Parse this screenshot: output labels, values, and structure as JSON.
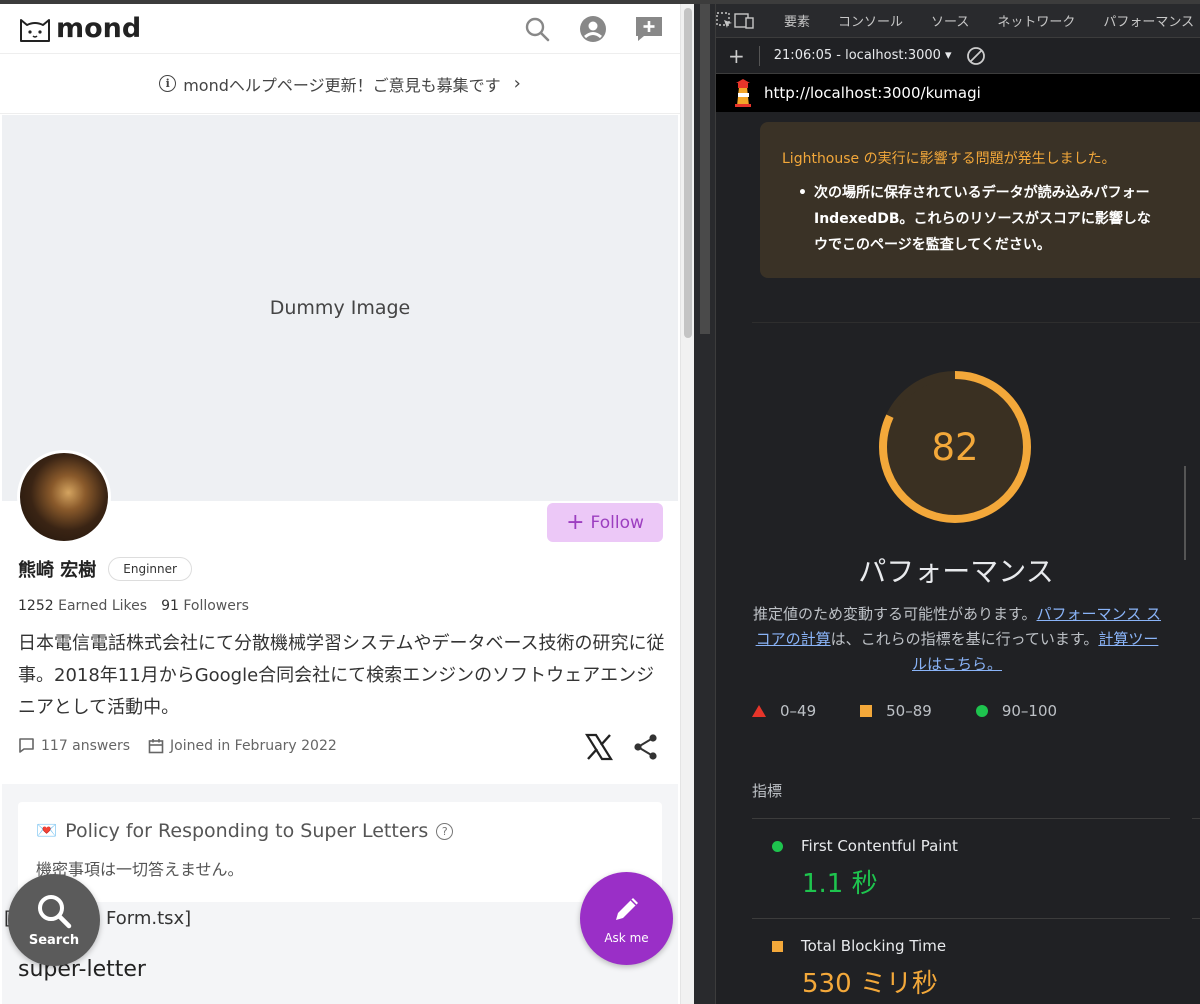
{
  "app": {
    "logo_text": "mond",
    "notice": "mondヘルプページ更新！ご意見も募集です",
    "cover_label": "Dummy Image",
    "follow_label": "Follow",
    "profile": {
      "name": "熊崎 宏樹",
      "tag": "Enginner",
      "earned_likes_count": "1252",
      "earned_likes_label": "Earned Likes",
      "followers_count": "91",
      "followers_label": "Followers",
      "bio": "日本電信電話株式会社にて分散機械学習システムやデータベース技術の研究に従事。2018年11月からGoogle合同会社にて検索エンジンのソフトウェアエンジニアとして活動中。",
      "answers": "117 answers",
      "joined": "Joined in February 2022"
    },
    "policy": {
      "emoji": "💌",
      "title": "Policy for Responding to Super Letters",
      "body": "機密事項は一切答えません。"
    },
    "code_line_left": "[",
    "code_line_right": "Form.tsx]",
    "section_title": "super-letter",
    "fab_search_label": "Search",
    "fab_ask_label": "Ask me"
  },
  "devtools": {
    "tabs": [
      "要素",
      "コンソール",
      "ソース",
      "ネットワーク",
      "パフォーマンス"
    ],
    "session": "21:06:05 - localhost:3000 ▾",
    "url": "http://localhost:3000/kumagi",
    "warning": {
      "title": "Lighthouse の実行に影響する問題が発生しました。",
      "line1": "次の場所に保存されているデータが読み込みパフォー",
      "line2": "IndexedDB。これらのリソースがスコアに影響しな",
      "line3": "ウでこのページを監査してください。"
    },
    "score": 82,
    "score_color": "#f3a83a",
    "category": "パフォーマンス",
    "desc_pre": "推定値のため変動する可能性があります。",
    "desc_link1": "パフォーマンス スコアの計算",
    "desc_mid": "は、これらの指標を基に行っています。",
    "desc_link2": "計算ツールはこちら。",
    "legend": {
      "fail": "0–49",
      "average": "50–89",
      "pass": "90–100"
    },
    "metrics_label": "指標",
    "metrics": [
      {
        "name": "First Contentful Paint",
        "value": "1.1 秒",
        "status": "pass",
        "color": "#1ec44e"
      },
      {
        "name": "Total Blocking Time",
        "value": "530 ミリ秒",
        "status": "average",
        "color": "#f3a83a"
      }
    ]
  }
}
